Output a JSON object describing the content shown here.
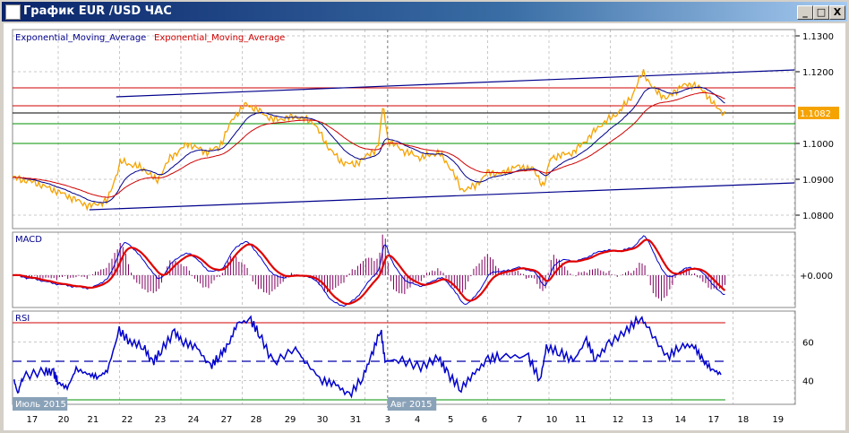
{
  "window": {
    "title": "График EUR /USD  ЧАС",
    "minimize": "_",
    "maximize": "□",
    "close": "X"
  },
  "legend": {
    "ema1": "Exponential_Moving_Average",
    "ema2": "Exponential_Moving_Average"
  },
  "colors": {
    "price": "#f5a300",
    "ema_fast": "#00008b",
    "ema_slow": "#d00000",
    "macd": "#0000cc",
    "signal": "#e00000",
    "hist": "#800060",
    "rsi": "#0000cc",
    "level_red": "#d00000",
    "level_green": "#009000",
    "trend": "#00008b"
  },
  "chart_data": [
    {
      "type": "line",
      "title": "EUR/USD H1",
      "current_price_label": "1.1082",
      "current_price": 1.1082,
      "yticks": [
        "1.1300",
        "1.1200",
        "1.1000",
        "1.0900",
        "1.0800"
      ],
      "ytick_values": [
        1.13,
        1.12,
        1.1,
        1.09,
        1.08
      ],
      "ylim": [
        1.0775,
        1.1325
      ],
      "xlim_days": [
        0,
        23.6
      ],
      "price": [
        [
          0,
          1.0905
        ],
        [
          0.7,
          1.089
        ],
        [
          1.51,
          1.086
        ],
        [
          2.32,
          1.0825
        ],
        [
          2.86,
          1.084
        ],
        [
          3.27,
          1.095
        ],
        [
          3.95,
          1.093
        ],
        [
          4.35,
          1.0895
        ],
        [
          4.76,
          1.096
        ],
        [
          5.3,
          1.1
        ],
        [
          5.84,
          1.0975
        ],
        [
          6.24,
          1.099
        ],
        [
          6.65,
          1.107
        ],
        [
          7.05,
          1.111
        ],
        [
          7.46,
          1.109
        ],
        [
          7.86,
          1.1065
        ],
        [
          8.54,
          1.1075
        ],
        [
          9.08,
          1.106
        ],
        [
          9.49,
          1.0995
        ],
        [
          9.89,
          1.095
        ],
        [
          10.3,
          1.094
        ],
        [
          10.7,
          1.0965
        ],
        [
          11.03,
          1.099
        ],
        [
          11.19,
          1.111
        ],
        [
          11.32,
          1.101
        ],
        [
          11.78,
          1.098
        ],
        [
          12.32,
          1.096
        ],
        [
          12.86,
          1.0975
        ],
        [
          13.27,
          1.0925
        ],
        [
          13.54,
          1.087
        ],
        [
          13.95,
          1.088
        ],
        [
          14.35,
          1.092
        ],
        [
          14.76,
          1.0915
        ],
        [
          15.16,
          1.0935
        ],
        [
          15.7,
          1.093
        ],
        [
          16.03,
          1.088
        ],
        [
          16.24,
          1.096
        ],
        [
          16.92,
          1.0975
        ],
        [
          17.32,
          1.101
        ],
        [
          17.73,
          1.105
        ],
        [
          18.27,
          1.1085
        ],
        [
          18.68,
          1.113
        ],
        [
          19.03,
          1.12
        ],
        [
          19.35,
          1.115
        ],
        [
          19.76,
          1.1125
        ],
        [
          20.16,
          1.116
        ],
        [
          20.57,
          1.1165
        ],
        [
          20.92,
          1.114
        ],
        [
          21.24,
          1.11
        ],
        [
          21.51,
          1.1082
        ]
      ],
      "levels": [
        {
          "price": 1.1155,
          "color": "red"
        },
        {
          "price": 1.1105,
          "color": "red"
        },
        {
          "price": 1.1085,
          "color": "black"
        },
        {
          "price": 1.1055,
          "color": "green"
        },
        {
          "price": 1.1,
          "color": "green"
        }
      ],
      "trendlines": [
        [
          [
            3.13,
            1.113
          ],
          [
            23.6,
            1.1205
          ]
        ],
        [
          [
            2.32,
            1.0815
          ],
          [
            23.6,
            1.089
          ]
        ]
      ]
    },
    {
      "type": "line",
      "title": "MACD",
      "ytick": "+0.000"
    },
    {
      "type": "line",
      "title": "RSI",
      "yticks": [
        "60",
        "40"
      ],
      "ytick_values": [
        60,
        40
      ],
      "ylim": [
        25,
        77
      ],
      "levels": [
        70,
        50,
        30
      ],
      "rsi": [
        [
          0.05,
          40
        ],
        [
          0.16,
          33
        ],
        [
          0.3,
          42
        ],
        [
          0.97,
          45
        ],
        [
          1.24,
          44
        ],
        [
          1.38,
          39
        ],
        [
          1.65,
          36
        ],
        [
          1.92,
          46
        ],
        [
          2.32,
          43
        ],
        [
          2.59,
          42
        ],
        [
          2.86,
          45
        ],
        [
          3.22,
          66
        ],
        [
          3.54,
          60
        ],
        [
          3.95,
          58
        ],
        [
          4.22,
          49
        ],
        [
          4.49,
          56
        ],
        [
          4.89,
          65
        ],
        [
          5.16,
          60
        ],
        [
          5.57,
          57
        ],
        [
          5.97,
          47
        ],
        [
          6.24,
          53
        ],
        [
          6.51,
          58
        ],
        [
          6.78,
          70
        ],
        [
          7.19,
          71
        ],
        [
          7.46,
          64
        ],
        [
          7.86,
          49
        ],
        [
          8.54,
          57
        ],
        [
          8.81,
          50
        ],
        [
          9.35,
          40
        ],
        [
          9.76,
          38
        ],
        [
          10.16,
          32
        ],
        [
          10.57,
          42
        ],
        [
          10.84,
          53
        ],
        [
          11.11,
          67
        ],
        [
          11.24,
          50
        ],
        [
          11.65,
          51
        ],
        [
          12.32,
          47
        ],
        [
          12.86,
          52
        ],
        [
          13.14,
          43
        ],
        [
          13.54,
          36
        ],
        [
          13.95,
          44
        ],
        [
          14.35,
          51
        ],
        [
          14.76,
          53
        ],
        [
          15.57,
          52
        ],
        [
          15.92,
          40
        ],
        [
          16.11,
          57
        ],
        [
          16.51,
          55
        ],
        [
          16.92,
          50
        ],
        [
          17.32,
          61
        ],
        [
          17.59,
          51
        ],
        [
          18.0,
          59
        ],
        [
          18.54,
          66
        ],
        [
          18.95,
          73
        ],
        [
          19.22,
          66
        ],
        [
          19.76,
          52
        ],
        [
          20.16,
          58
        ],
        [
          20.57,
          58
        ],
        [
          20.84,
          50
        ],
        [
          21.11,
          46
        ],
        [
          21.38,
          43
        ]
      ]
    },
    {
      "type": "axis",
      "xticks": [
        [
          "17",
          0.59
        ],
        [
          "20",
          1.54
        ],
        [
          "21",
          2.43
        ],
        [
          "22",
          3.46
        ],
        [
          "23",
          4.46
        ],
        [
          "24",
          5.46
        ],
        [
          "27",
          6.46
        ],
        [
          "28",
          7.35
        ],
        [
          "29",
          8.38
        ],
        [
          "30",
          9.35
        ],
        [
          "31",
          10.35
        ],
        [
          "3",
          11.32
        ],
        [
          "4",
          12.22
        ],
        [
          "5",
          13.22
        ],
        [
          "6",
          14.24
        ],
        [
          "7",
          15.3
        ],
        [
          "10",
          16.27
        ],
        [
          "11",
          17.14
        ],
        [
          "12",
          18.27
        ],
        [
          "13",
          19.16
        ],
        [
          "14",
          20.16
        ],
        [
          "17",
          21.16
        ],
        [
          "18",
          22.05
        ],
        [
          "19",
          23.1
        ]
      ],
      "months": [
        [
          "Июль 2015",
          0
        ],
        [
          "Авг 2015",
          11.32
        ]
      ],
      "crosshair_day": 11.32
    }
  ]
}
